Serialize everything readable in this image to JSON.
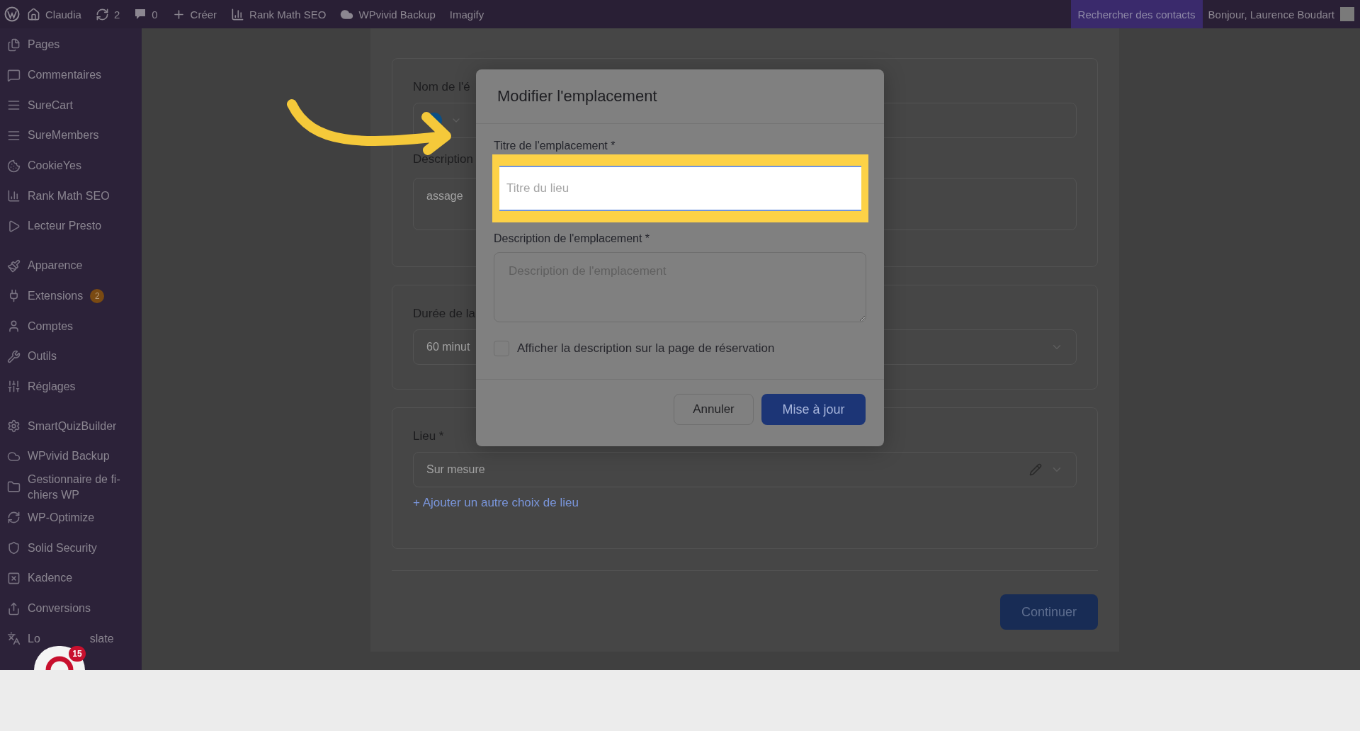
{
  "top_bar": {
    "items": [
      {
        "label": "Claudia"
      },
      {
        "label": "2"
      },
      {
        "label": "0"
      },
      {
        "label": "Créer"
      },
      {
        "label": "Rank Math SEO"
      },
      {
        "label": "WPvivid Backup"
      },
      {
        "label": "Imagify"
      }
    ],
    "search_contacts": "Rechercher des contacts",
    "greeting": "Bonjour, Laurence Boudart"
  },
  "sidebar": {
    "groups": [
      [
        {
          "label": "Pages"
        },
        {
          "label": "Commentaires"
        },
        {
          "label": "SureCart"
        },
        {
          "label": "SureMembers"
        },
        {
          "label": "CookieYes"
        },
        {
          "label": "Rank Math SEO"
        },
        {
          "label": "Lecteur Presto"
        }
      ],
      [
        {
          "label": "Apparence"
        },
        {
          "label": "Extensions",
          "badge": "2"
        },
        {
          "label": "Comptes"
        },
        {
          "label": "Outils"
        },
        {
          "label": "Réglages"
        }
      ],
      [
        {
          "label": "SmartQuizBuilder"
        },
        {
          "label": "WPvivid Backup"
        },
        {
          "label": "Gestionnaire de fi-chiers WP"
        },
        {
          "label": "WP-Optimize"
        },
        {
          "label": "Solid Security"
        },
        {
          "label": "Kadence"
        },
        {
          "label": "Conversions"
        },
        {
          "label": "Lo",
          "label_after": "slate"
        }
      ]
    ],
    "chat_badge": "15"
  },
  "form": {
    "name_label": "Nom de l'é",
    "description_label": "Description",
    "description_placeholder": "assage",
    "duration_label": "Durée de la",
    "duration_value": "60 minut",
    "location_label": "Lieu *",
    "location_value": "Sur mesure",
    "add_location_link": "+ Ajouter un autre choix de lieu",
    "continue_button": "Continuer"
  },
  "modal": {
    "title": "Modifier l'emplacement",
    "title_label": "Titre de l'emplacement *",
    "title_placeholder": "Titre du lieu",
    "description_label": "Description de l'emplacement *",
    "description_placeholder": "Description de l'emplacement",
    "show_description": {
      "label": "Afficher la description sur la page de réservation",
      "checked": false
    },
    "cancel_button": "Annuler",
    "update_button": "Mise à jour"
  }
}
